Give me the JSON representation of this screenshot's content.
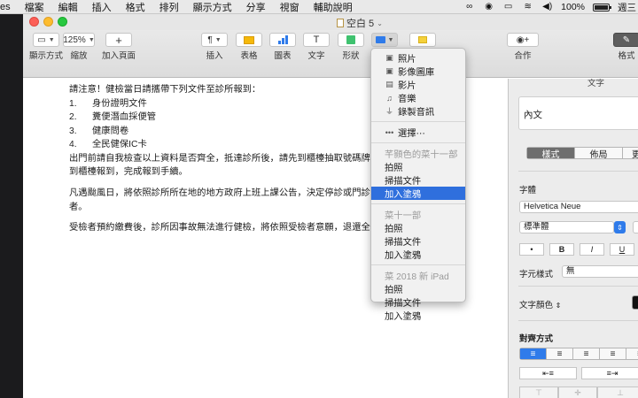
{
  "menubar": {
    "items": [
      "es",
      "檔案",
      "編輯",
      "插入",
      "格式",
      "排列",
      "顯示方式",
      "分享",
      "視窗",
      "輔助說明"
    ],
    "battery_label": "100%",
    "battery_level": 1.0,
    "clock": "週三"
  },
  "window": {
    "title": "空白 5",
    "toolbar": {
      "view": {
        "label": "顯示方式"
      },
      "zoom": {
        "value": "125%",
        "label": "縮放"
      },
      "add_page": {
        "label": "加入頁面"
      },
      "insert": {
        "label": "插入"
      },
      "table": {
        "label": "表格"
      },
      "chart": {
        "label": "圖表"
      },
      "text": {
        "label": "文字"
      },
      "shape": {
        "label": "形狀"
      },
      "collaborate": {
        "label": "合作"
      },
      "format": {
        "label": "格式"
      }
    }
  },
  "document": {
    "lines": [
      "請注意！健檢當日請攜帶下列文件至診所報到：",
      "出門前請自我檢查以上資料是否齊全，抵達診所後，請先到櫃檯抽取號碼牌，",
      "到櫃檯報到，完成報到手續。",
      "凡遇颱風日，將依照診所所在地的地方政府上班上課公告，決定停診或門診，",
      "者。",
      "受檢者預約繳費後，診所因事故無法進行健檢，將依照受檢者意願，退還全數"
    ],
    "list": [
      {
        "num": "1.",
        "text": "身份證明文件"
      },
      {
        "num": "2.",
        "text": "糞便潛血採便管"
      },
      {
        "num": "3.",
        "text": "健康問卷"
      },
      {
        "num": "4.",
        "text": "全民健保IC卡"
      }
    ]
  },
  "popup_menu": {
    "media_items": [
      {
        "icon": "photo-icon",
        "label": "照片"
      },
      {
        "icon": "photo-browser-icon",
        "label": "影像圖庫"
      },
      {
        "icon": "film-icon",
        "label": "影片"
      },
      {
        "icon": "music-note-icon",
        "label": "音樂"
      },
      {
        "icon": "microphone-icon",
        "label": "錄製音訊"
      }
    ],
    "choose": "選擇⋯",
    "devices": [
      {
        "name": "芊顥色的菜十一部",
        "actions": [
          "拍照",
          "掃描文件",
          "加入塗鴉"
        ]
      },
      {
        "name": "菜十一部",
        "actions": [
          "拍照",
          "掃描文件",
          "加入塗鴉"
        ]
      },
      {
        "name": "菜 2018 新 iPad",
        "actions": [
          "拍照",
          "掃描文件",
          "加入塗鴉"
        ]
      }
    ]
  },
  "format_panel": {
    "header": "文字",
    "paragraph_style": "內文",
    "tabs": [
      "樣式",
      "佈局",
      "更"
    ],
    "font_section_label": "字體",
    "font_name": "Helvetica Neue",
    "font_style": "標準體",
    "style_buttons": [
      "•",
      "B",
      "I",
      "U",
      "U"
    ],
    "char_style_label": "字元樣式",
    "char_style_value": "無",
    "text_color_label": "文字顏色",
    "alignment_label": "對齊方式",
    "colors": {
      "accent": "#2f7bea",
      "highlight": "#2f6fdd",
      "text_color": "#111111"
    }
  }
}
